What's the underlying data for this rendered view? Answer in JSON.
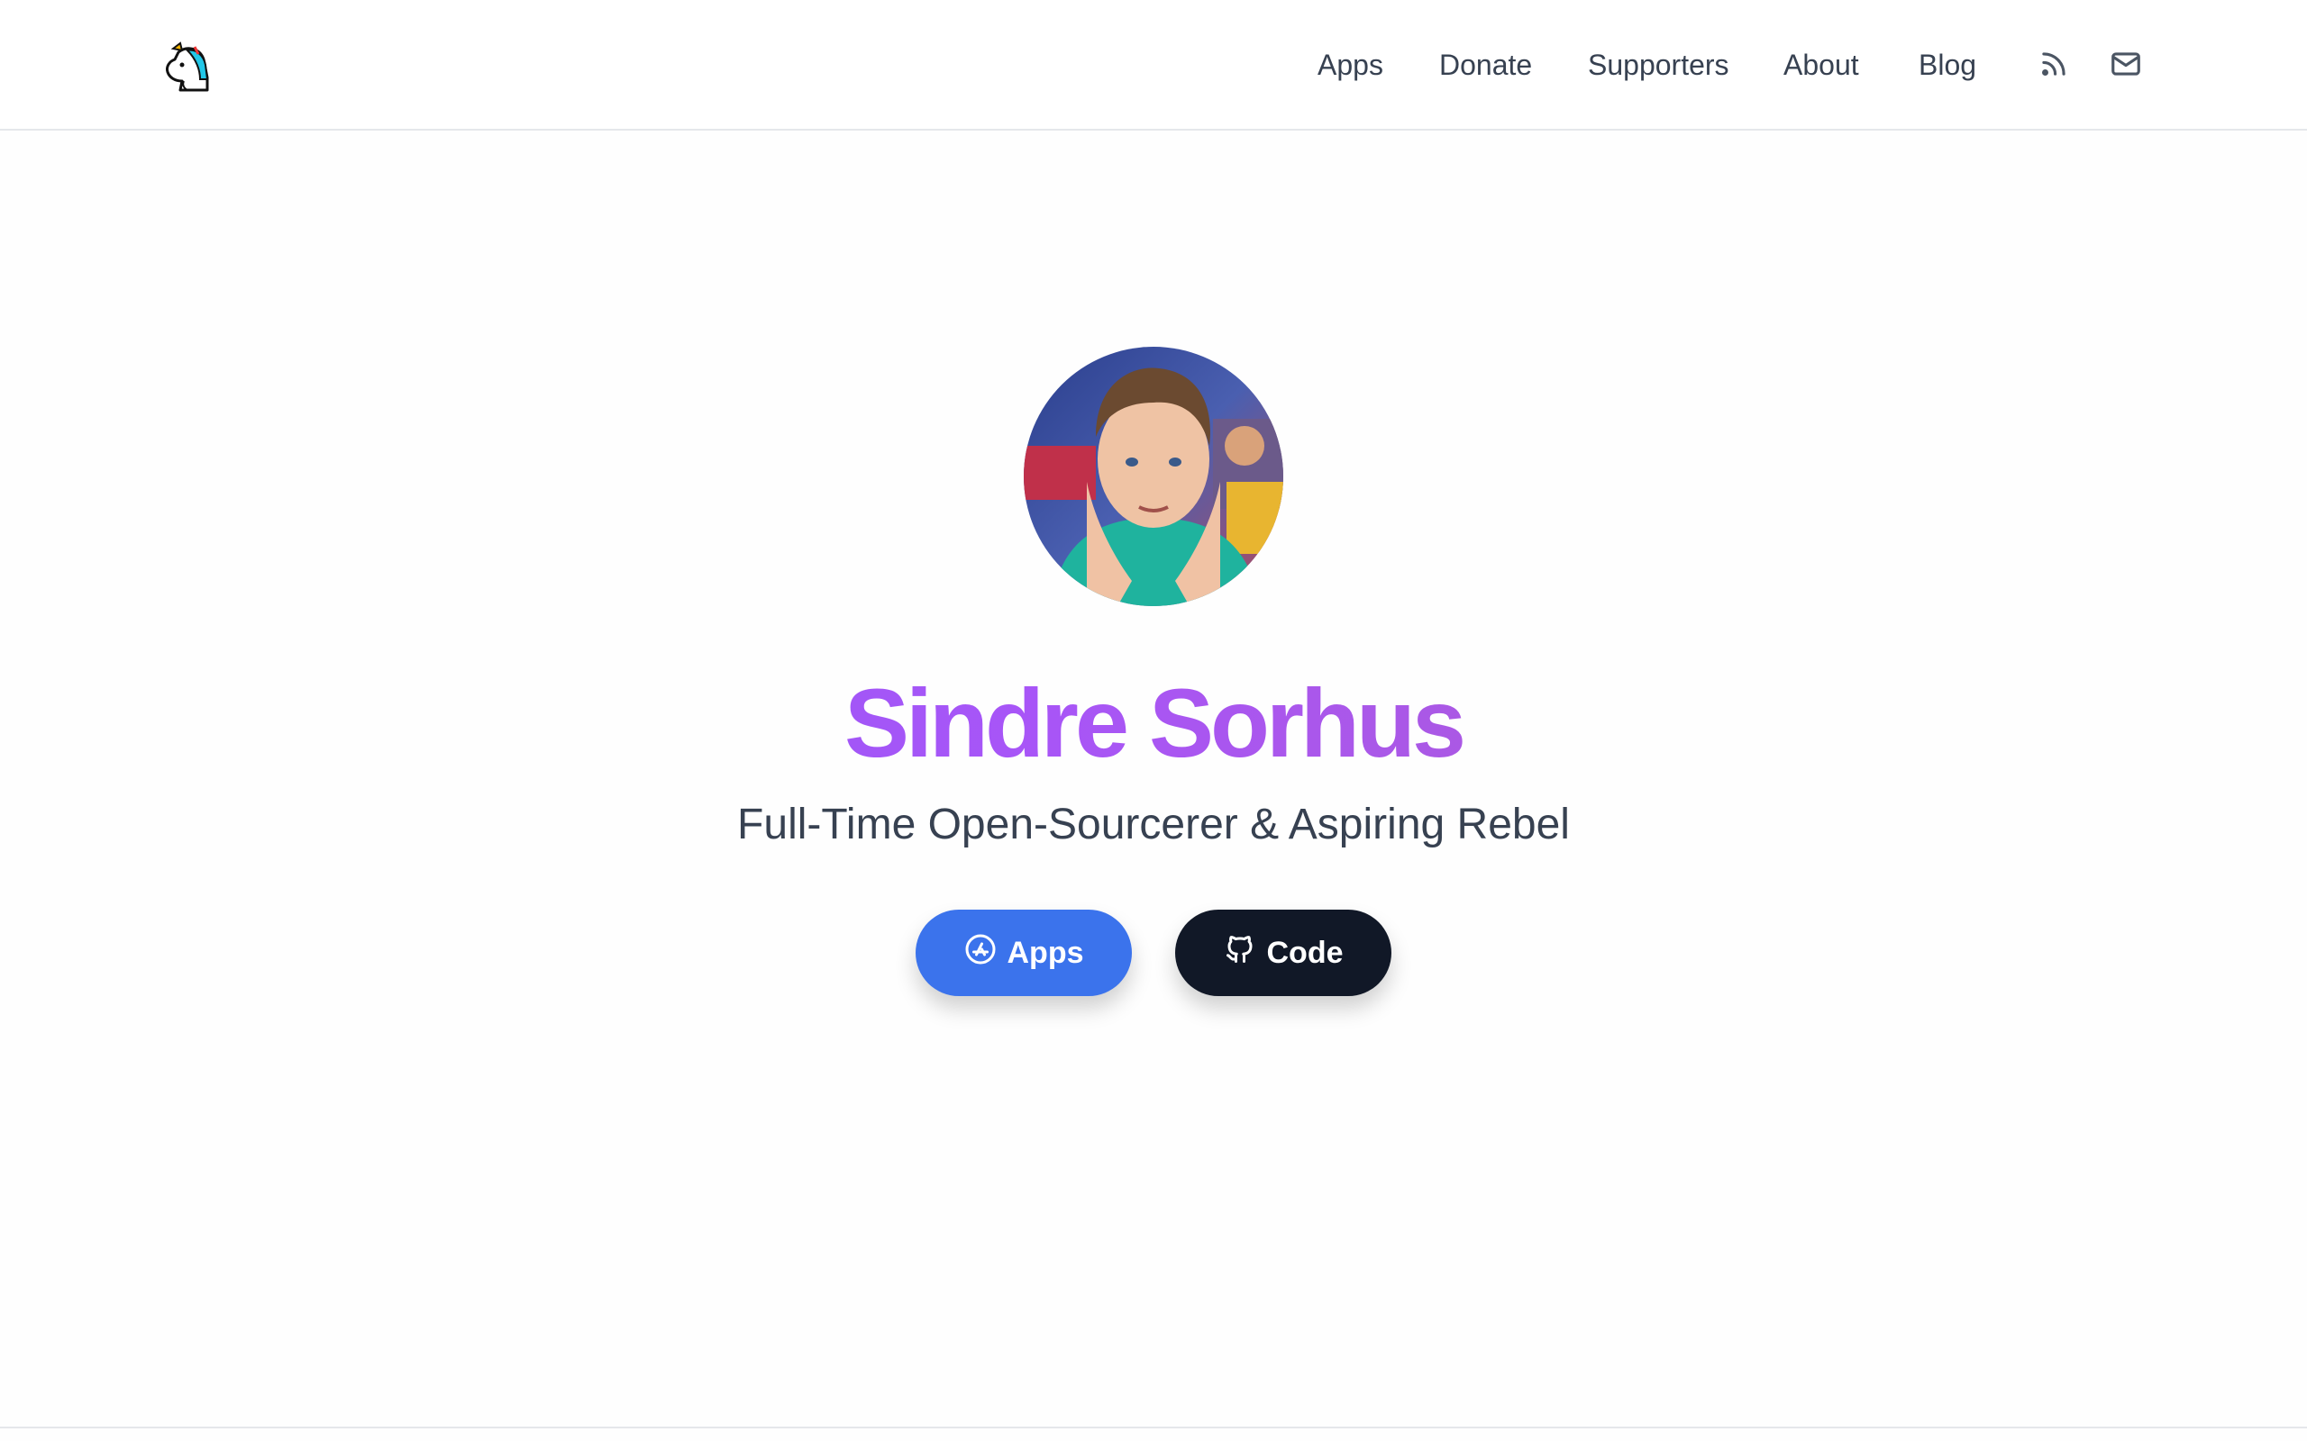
{
  "header": {
    "logo_icon": "unicorn-icon",
    "nav": [
      {
        "label": "Apps"
      },
      {
        "label": "Donate"
      },
      {
        "label": "Supporters"
      },
      {
        "label": "About"
      },
      {
        "label": "Blog"
      }
    ],
    "rss_icon": "rss-icon",
    "mail_icon": "mail-icon"
  },
  "hero": {
    "name": "Sindre Sorhus",
    "tagline": "Full-Time Open-Sourcerer & Aspiring Rebel",
    "buttons": {
      "apps_label": "Apps",
      "apps_icon": "app-store-icon",
      "code_label": "Code",
      "code_icon": "github-icon"
    }
  },
  "colors": {
    "name_gradient_start": "#8b5cf6",
    "name_gradient_end": "#b05fc0",
    "apps_button": "#3b73ec",
    "code_button": "#111827"
  }
}
